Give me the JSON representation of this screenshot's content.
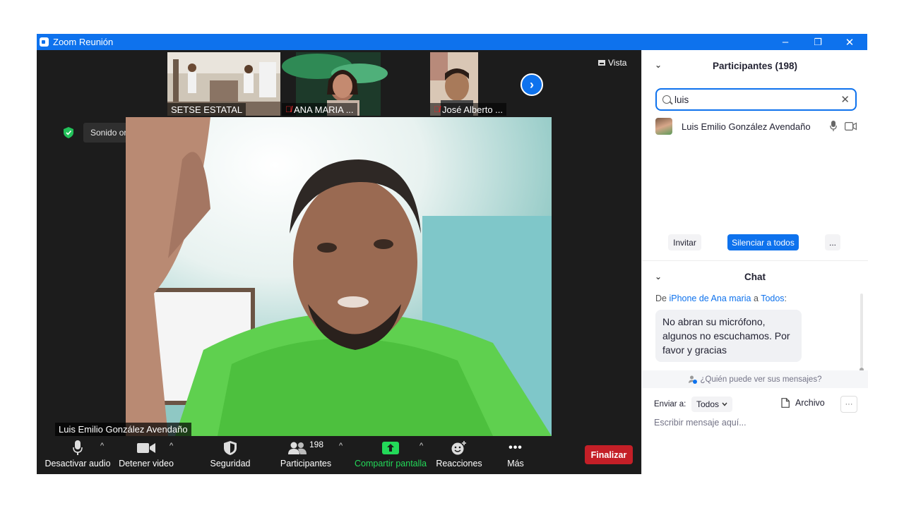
{
  "window": {
    "title": "Zoom Reunión",
    "minimize": "–",
    "restore": "❐",
    "close": "✕"
  },
  "gallery": {
    "thumbnails": [
      {
        "label": "SETSE ESTATAL",
        "muted": false
      },
      {
        "label": "ANA MARIA ...",
        "muted": true
      },
      {
        "label": "José Alberto ...",
        "muted": true
      }
    ],
    "next": "›",
    "view_label": "Vista"
  },
  "sound": {
    "label": "Sonido original: desactivado",
    "caret": "▼"
  },
  "speaker": {
    "name": "Luis Emilio González Avendaño"
  },
  "toolbar": {
    "mute_label": "Desactivar audio",
    "video_label": "Detener video",
    "security_label": "Seguridad",
    "participants_label": "Participantes",
    "participants_count": "198",
    "share_label": "Compartir pantalla",
    "reactions_label": "Reacciones",
    "more_label": "Más",
    "chevron": "^",
    "end_label": "Finalizar",
    "share_color": "#23d959",
    "end_color": "#c41f27"
  },
  "participants_panel": {
    "title": "Participantes (198)",
    "collapse": "⌄",
    "search_value": "luis",
    "clear": "✕",
    "results": [
      {
        "name": "Luis Emilio González Avendaño"
      }
    ],
    "invite_label": "Invitar",
    "mute_all_label": "Silenciar a todos",
    "more_label": "..."
  },
  "chat": {
    "title": "Chat",
    "collapse": "⌄",
    "from_prefix": "De ",
    "sender": "iPhone de Ana maria",
    "to_word": " a ",
    "recipient": "Todos",
    "colon": ":",
    "message": "No abran su micrófono, algunos no escuchamos. Por favor y gracias",
    "who_sees": "¿Quién puede ver sus mensajes?",
    "send_to_label": "Enviar a:",
    "send_to_value": "Todos",
    "file_label": "Archivo",
    "more": "···",
    "placeholder": "Escribir mensaje aquí..."
  },
  "colors": {
    "accent": "#0e72ed",
    "meeting_bg": "#1c1c1c"
  }
}
